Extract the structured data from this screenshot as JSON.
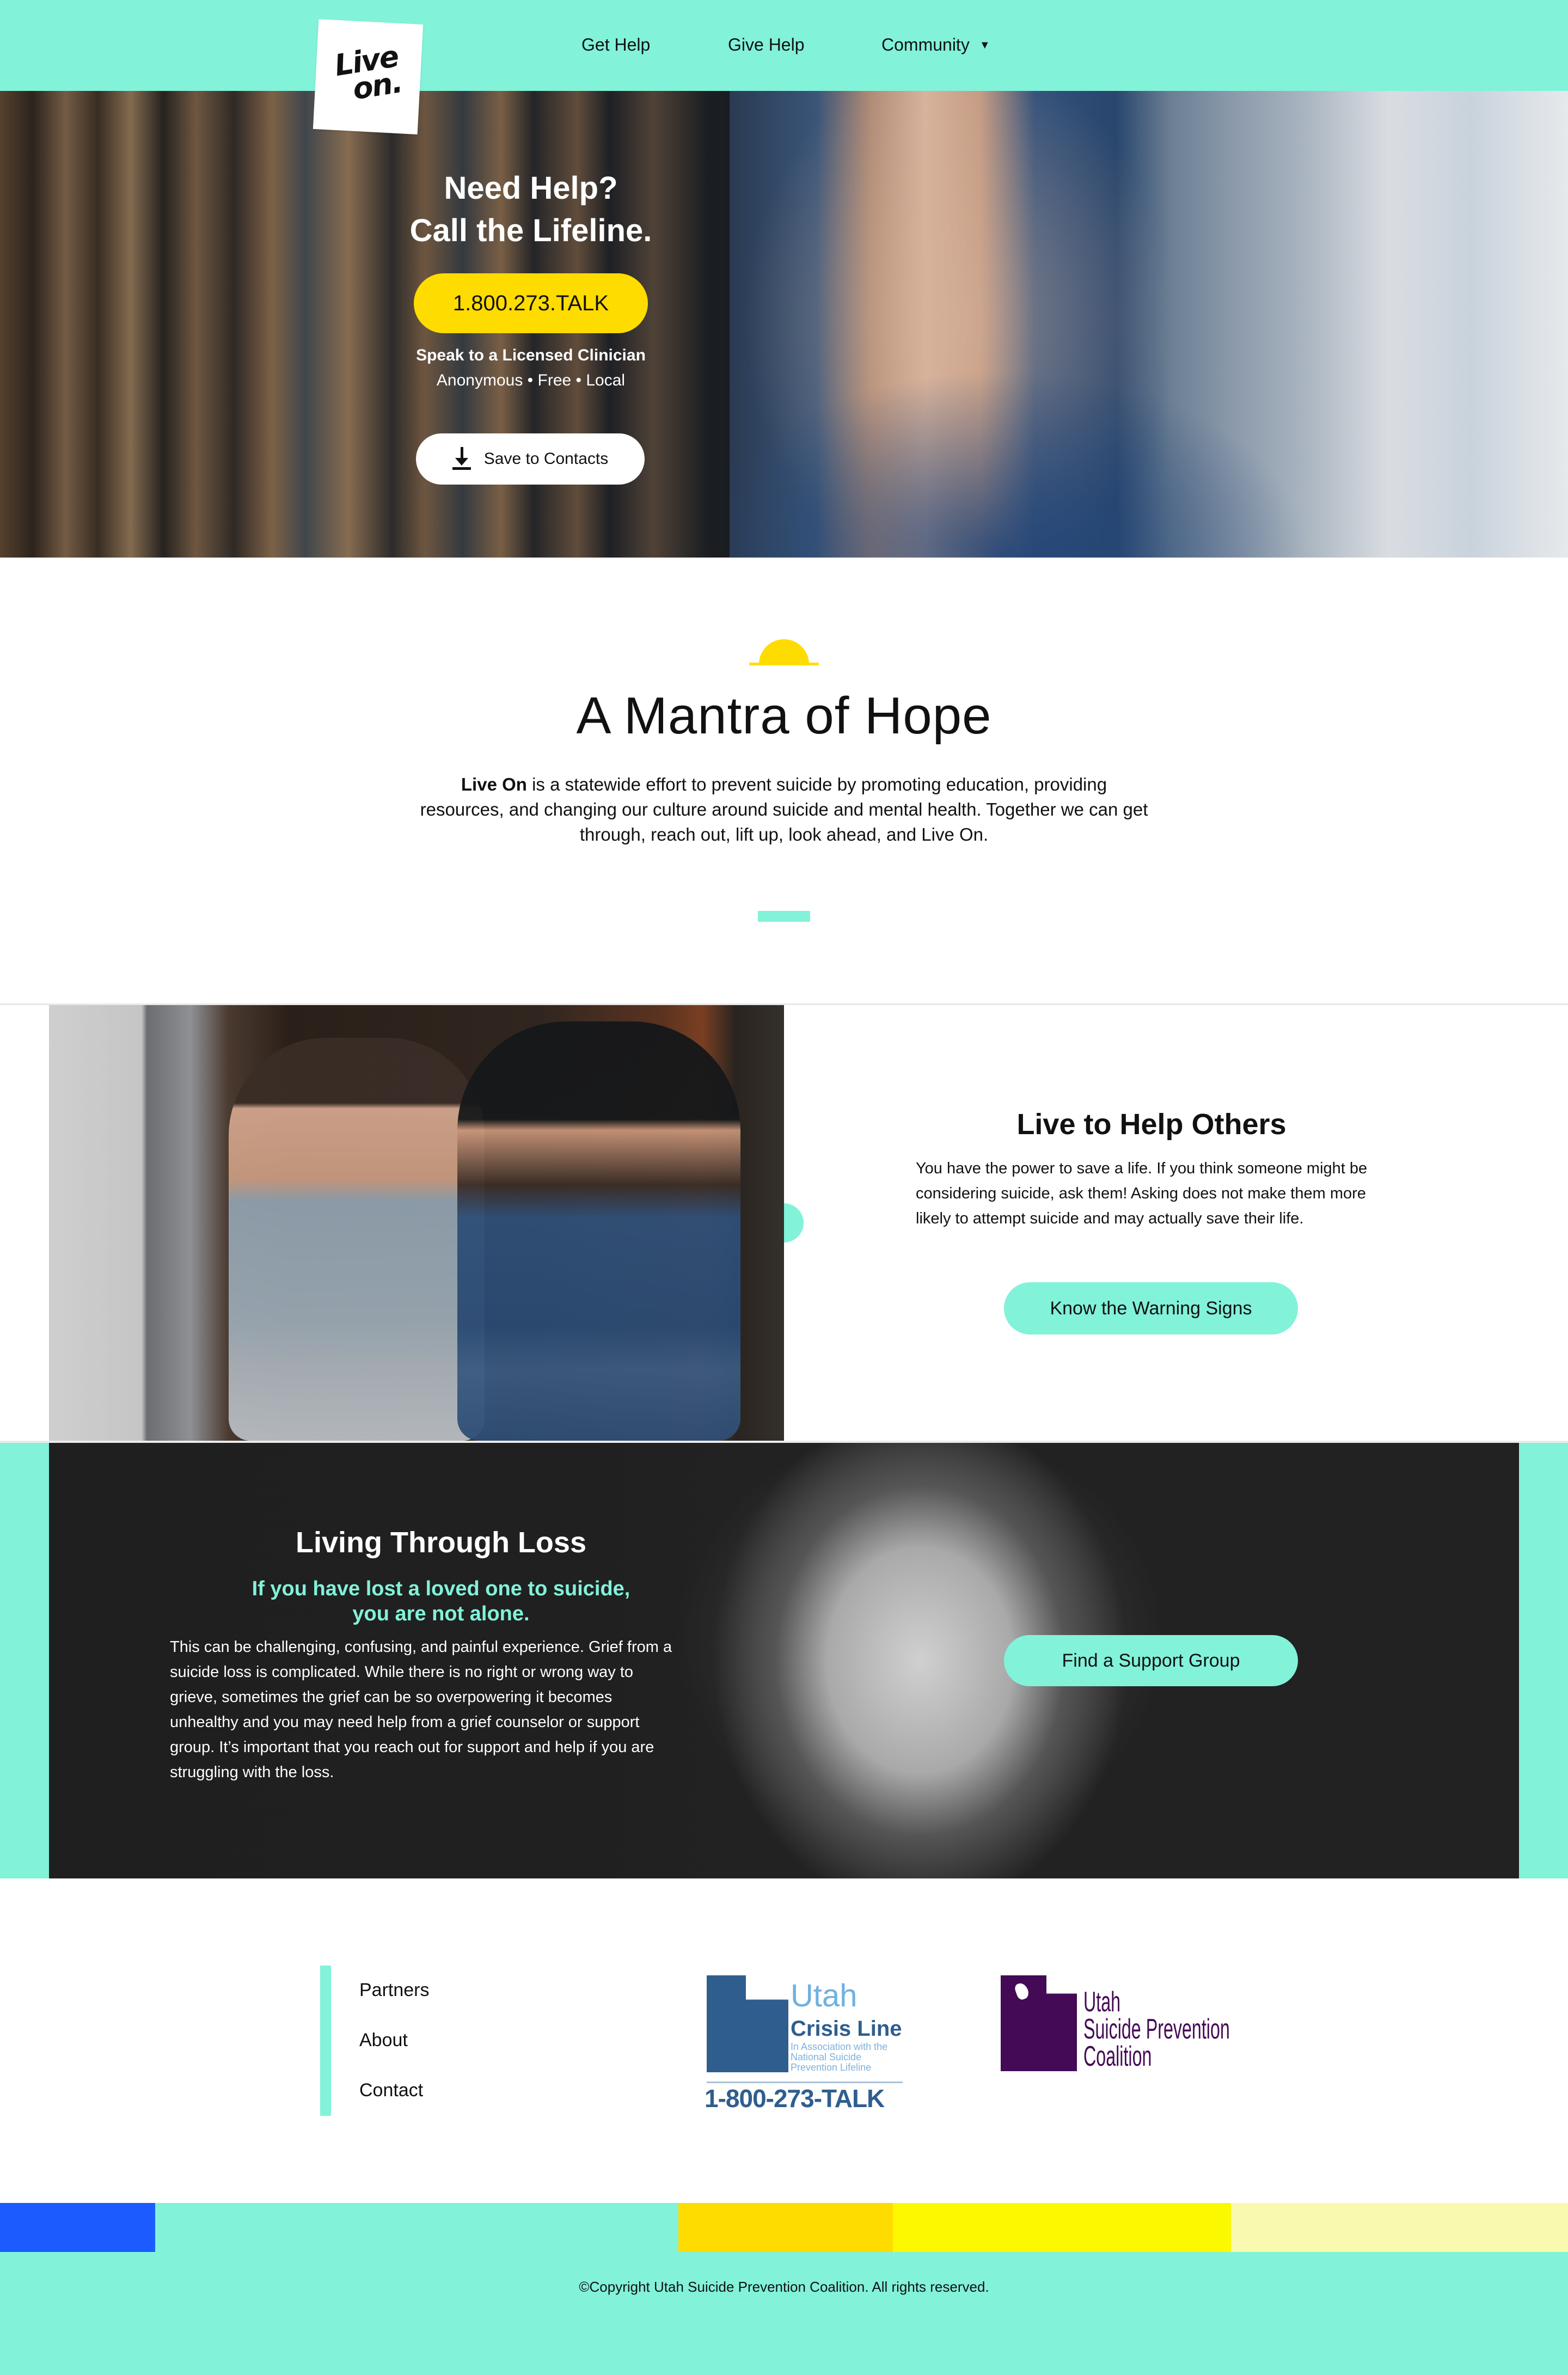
{
  "header": {
    "logo": {
      "line1": "Live",
      "line2": "on."
    },
    "nav": [
      {
        "label": "Get Help"
      },
      {
        "label": "Give Help"
      },
      {
        "label": "Community",
        "icon": "caret-down-icon",
        "glyph": "▼"
      }
    ]
  },
  "hero": {
    "title_line1": "Need Help?",
    "title_line2": "Call the Lifeline.",
    "call_button": "1.800.273.TALK",
    "subtitle": "Speak to a Licensed Clinician",
    "tagline": "Anonymous • Free • Local",
    "save_button": "Save to Contacts",
    "save_icon": "download-icon"
  },
  "mantra": {
    "icon": "sun-icon",
    "title": "A Mantra of Hope",
    "body_bold": "Live On",
    "body_rest": " is a statewide effort to prevent suicide by promoting education, providing resources, and changing our culture around suicide and mental health. Together we can get through, reach out, lift up, look ahead, and Live On."
  },
  "help_others": {
    "title": "Live to Help Others",
    "body": "You have the power to save a life. If you think someone might be considering suicide, ask them! Asking does not make them more likely to attempt suicide and may actually save their life.",
    "button": "Know the Warning Signs"
  },
  "loss": {
    "title": "Living Through Loss",
    "subtitle_line1": "If you have lost a loved one to suicide,",
    "subtitle_line2": "you are not alone.",
    "body": "This can be challenging, confusing, and painful experience. Grief from a suicide loss is complicated. While there is no right or wrong way to grieve, sometimes the grief can be so overpowering it becomes unhealthy and you may need help from a grief counselor or support group. It’s important that you reach out for support and help if you are struggling with the loss.",
    "button": "Find a Support Group"
  },
  "footer": {
    "links": [
      {
        "label": "Partners"
      },
      {
        "label": "About"
      },
      {
        "label": "Contact"
      }
    ],
    "partners": [
      {
        "name": "Utah Crisis Line",
        "line1": "Utah",
        "line2": "Crisis Line",
        "line3": "In Association with the National Suicide Prevention Lifeline",
        "phone": "1-800-273-TALK"
      },
      {
        "name": "Utah Suicide Prevention Coalition",
        "line1": "Utah",
        "line2": "Suicide Prevention",
        "line3": "Coalition"
      }
    ],
    "copyright": "©Copyright Utah Suicide Prevention Coalition. All rights reserved."
  },
  "colors": {
    "accent_teal": "#82f2d9",
    "call_yellow": "#ffdc00",
    "strip": [
      "#1c5cff",
      "#82f2d9",
      "#ffdc00",
      "#fcf800",
      "#faf9b0"
    ],
    "ucl_blue": "#2f5e8e",
    "uspc_purple": "#440a55"
  }
}
